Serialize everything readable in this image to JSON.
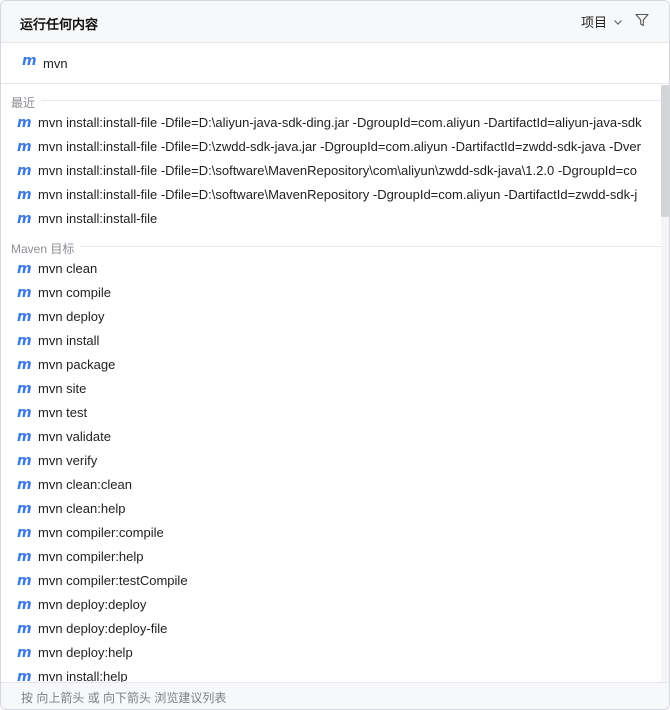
{
  "header": {
    "title": "运行任何内容",
    "scope_label": "项目",
    "scope_icon": "chevron-down-icon",
    "filter_icon": "filter-icon"
  },
  "search": {
    "icon": "maven-icon",
    "icon_glyph": "m",
    "value": "mvn"
  },
  "recent": {
    "heading": "最近",
    "items": [
      "mvn install:install-file -Dfile=D:\\aliyun-java-sdk-ding.jar -DgroupId=com.aliyun -DartifactId=aliyun-java-sdk",
      "mvn install:install-file -Dfile=D:\\zwdd-sdk-java.jar -DgroupId=com.aliyun -DartifactId=zwdd-sdk-java -Dver",
      "mvn install:install-file -Dfile=D:\\software\\MavenRepository\\com\\aliyun\\zwdd-sdk-java\\1.2.0 -DgroupId=co",
      "mvn install:install-file -Dfile=D:\\software\\MavenRepository -DgroupId=com.aliyun -DartifactId=zwdd-sdk-j",
      "mvn install:install-file"
    ]
  },
  "goals": {
    "heading": "Maven 目标",
    "items": [
      "mvn clean",
      "mvn compile",
      "mvn deploy",
      "mvn install",
      "mvn package",
      "mvn site",
      "mvn test",
      "mvn validate",
      "mvn verify",
      "mvn clean:clean",
      "mvn clean:help",
      "mvn compiler:compile",
      "mvn compiler:help",
      "mvn compiler:testCompile",
      "mvn deploy:deploy",
      "mvn deploy:deploy-file",
      "mvn deploy:help",
      "mvn install:help"
    ]
  },
  "footer": {
    "hint": "按 向上箭头 或 向下箭头 浏览建议列表"
  },
  "colors": {
    "accent": "#3d7be4",
    "header_bg": "#f7f8fa",
    "section_text": "#8a8d93"
  }
}
